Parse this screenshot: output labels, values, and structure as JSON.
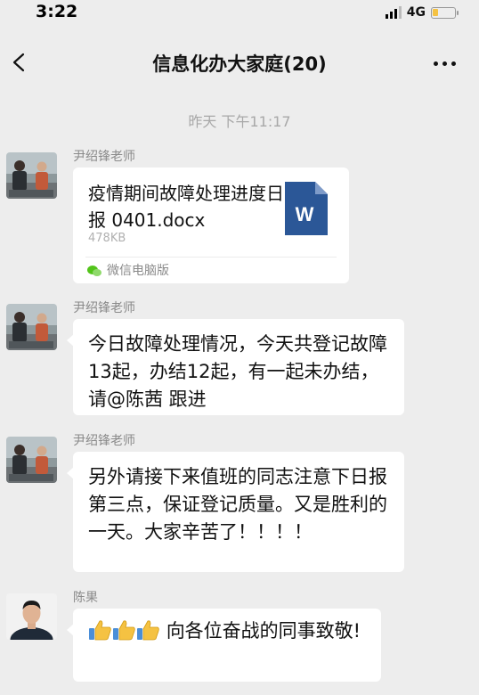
{
  "status_bar": {
    "time": "3:22",
    "network": "4G"
  },
  "nav": {
    "title": "信息化办大家庭(20)"
  },
  "timestamp": "昨天 下午11:17",
  "messages": [
    {
      "sender": "尹绍锋老师",
      "type": "file",
      "file_name": "疫情期间故障处理进度日报 0401.docx",
      "file_size": "478KB",
      "file_source": "微信电脑版",
      "file_icon": "word-icon",
      "file_icon_letter": "W"
    },
    {
      "sender": "尹绍锋老师",
      "type": "text",
      "text": "今日故障处理情况，今天共登记故障13起，办结12起，有一起未办结，请@陈茜 跟进"
    },
    {
      "sender": "尹绍锋老师",
      "type": "text",
      "text": "另外请接下来值班的同志注意下日报第三点，保证登记质量。又是胜利的一天。大家辛苦了！！！！"
    },
    {
      "sender": "陈果",
      "type": "text",
      "emoji": "thumbs-up-icon x3",
      "text": "向各位奋战的同事致敬!"
    }
  ],
  "colors": {
    "background": "#ededed",
    "bubble": "#ffffff",
    "word_blue": "#2b5797",
    "meta_gray": "#8a8a8a"
  }
}
